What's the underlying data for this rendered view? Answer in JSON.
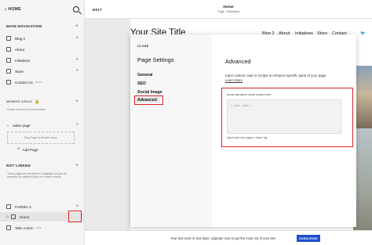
{
  "left_panel": {
    "home_label": "HOME",
    "main_navigation_label": "MAIN NAVIGATION",
    "main_items": [
      {
        "label": "Blog 2",
        "tag": ""
      },
      {
        "label": "About",
        "tag": ""
      },
      {
        "label": "Initiatives",
        "tag": ""
      },
      {
        "label": "Store",
        "tag": ""
      },
      {
        "label": "Contact Us",
        "tag": "CLICK"
      }
    ],
    "member_areas_label": "MEMBER AREAS",
    "member_desc": "Create content for your members.",
    "video_page_label": "video page",
    "drop_text": "Drag Pages to Member Areas",
    "add_page_label": "Add Page",
    "not_linked_label": "NOT LINKED",
    "not_linked_desc": "These pages are not linked in navigation but can be accessed by visitors by link or in search results.",
    "not_linked_items": [
      {
        "label": "Portfolio 3",
        "tag": ""
      },
      {
        "label": "Home",
        "tag": ""
      },
      {
        "label": "Take Action",
        "tag": "GIVE"
      }
    ]
  },
  "topbar": {
    "edit_label": "EDIT",
    "page_title": "Home",
    "page_subtitle": "Page · Published"
  },
  "site": {
    "title": "Your Site Title",
    "nav": [
      "Blog 2",
      "About",
      "Initiatives",
      "Store",
      "Contact"
    ]
  },
  "modal": {
    "close_label": "CLOSE",
    "title": "Page Settings",
    "nav": [
      "General",
      "SEO",
      "Social Image",
      "Advanced"
    ],
    "advanced": {
      "heading": "Advanced",
      "description": "Inject custom code or scripts to enhance specific parts of your page.",
      "learn_more": "Learn More",
      "injection_label": "PAGE HEADER CODE INJECTION",
      "placeholder": "1  Add code...",
      "hint": "Inject code in the page's <head> tag."
    }
  },
  "bottombar": {
    "trial_text": "Your trial ends in 163 days. Upgrade now to get the most out of your site.",
    "subscribe_label": "SUBSCRIBE"
  },
  "colors": {
    "highlight": "#dd2222",
    "subscribe": "#1d4fd1"
  }
}
